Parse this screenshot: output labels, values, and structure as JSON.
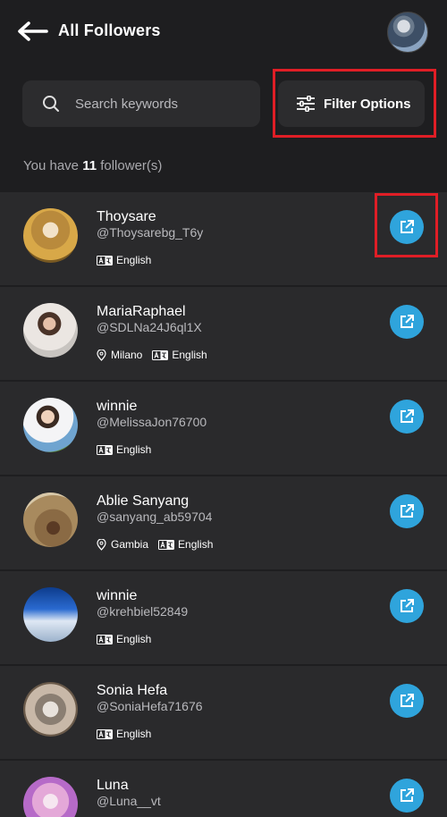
{
  "header": {
    "title": "All Followers",
    "search_placeholder": "Search keywords",
    "filter_label": "Filter Options",
    "count_prefix": "You have",
    "count_value": "11",
    "count_suffix": "follower(s)"
  },
  "colors": {
    "background": "#1e1e20",
    "row": "#2a2a2c",
    "accent": "#2fa4dc",
    "highlight": "#e01e26"
  },
  "followers": [
    {
      "name": "Thoysare",
      "handle": "@Thoysarebg_T6y",
      "location": "",
      "language": "English"
    },
    {
      "name": "MariaRaphael",
      "handle": "@SDLNa24J6ql1X",
      "location": "Milano",
      "language": "English"
    },
    {
      "name": "winnie",
      "handle": "@MelissaJon76700",
      "location": "",
      "language": "English"
    },
    {
      "name": "Ablie Sanyang",
      "handle": "@sanyang_ab59704",
      "location": "Gambia",
      "language": "English"
    },
    {
      "name": "winnie",
      "handle": "@krehbiel52849",
      "location": "",
      "language": "English"
    },
    {
      "name": "Sonia Hefa",
      "handle": "@SoniaHefa71676",
      "location": "",
      "language": "English"
    },
    {
      "name": "Luna",
      "handle": "@Luna__vt",
      "location": "",
      "language": ""
    }
  ]
}
